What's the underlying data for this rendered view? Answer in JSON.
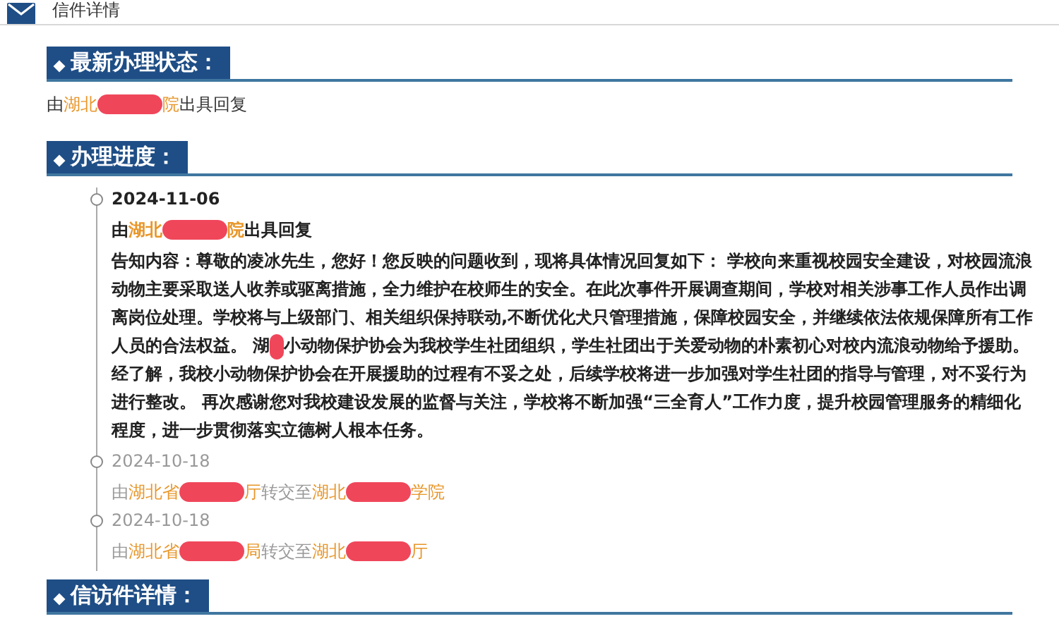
{
  "tab": {
    "title": "信件详情"
  },
  "latest_status": {
    "title": "最新办理状态：",
    "line": [
      {
        "kind": "text",
        "text": "由"
      },
      {
        "kind": "org",
        "text": "湖北"
      },
      {
        "kind": "redacted"
      },
      {
        "kind": "org",
        "text": "院"
      },
      {
        "kind": "text",
        "text": "出具回复"
      }
    ]
  },
  "progress": {
    "title": "办理进度：",
    "entries": [
      {
        "date": "2024-11-06",
        "current": true,
        "line": [
          {
            "kind": "text",
            "text": "由"
          },
          {
            "kind": "org",
            "text": "湖北"
          },
          {
            "kind": "redacted"
          },
          {
            "kind": "org",
            "text": "院"
          },
          {
            "kind": "text",
            "text": "出具回复"
          }
        ],
        "body": [
          {
            "kind": "text",
            "text": "告知内容：尊敬的凌冰先生，您好！您反映的问题收到，现将具体情况回复如下： 学校向来重视校园安全建设，对校园流浪动物主要采取送人收养或驱离措施，全力维护在校师生的安全。在此次事件开展调查期间，学校对相关涉事工作人员作出调离岗位处理。学校将与上级部门、相关组织保持联动,不断优化犬只管理措施，保障校园安全，并继续依法依规保障所有工作人员的合法权益。 湖"
          },
          {
            "kind": "redacted"
          },
          {
            "kind": "text",
            "text": "小动物保护协会为我校学生社团组织，学生社团出于关爱动物的朴素初心对校内流浪动物给予援助。经了解，我校小动物保护协会在开展援助的过程有不妥之处，后续学校将进一步加强对学生社团的指导与管理，对不妥行为进行整改。 再次感谢您对我校建设发展的监督与关注，学校将不断加强“三全育人”工作力度，提升校园管理服务的精细化程度，进一步贯彻落实立德树人根本任务。"
          }
        ]
      },
      {
        "date": "2024-10-18",
        "current": false,
        "line": [
          {
            "kind": "text",
            "text": "由"
          },
          {
            "kind": "org",
            "text": "湖北省"
          },
          {
            "kind": "redacted"
          },
          {
            "kind": "org",
            "text": "厅"
          },
          {
            "kind": "text",
            "text": "转交至"
          },
          {
            "kind": "org",
            "text": "湖北"
          },
          {
            "kind": "redacted"
          },
          {
            "kind": "org",
            "text": "学院"
          }
        ]
      },
      {
        "date": "2024-10-18",
        "current": false,
        "line": [
          {
            "kind": "text",
            "text": "由"
          },
          {
            "kind": "org",
            "text": "湖北省"
          },
          {
            "kind": "redacted"
          },
          {
            "kind": "org",
            "text": "局"
          },
          {
            "kind": "text",
            "text": "转交至"
          },
          {
            "kind": "org",
            "text": "湖北"
          },
          {
            "kind": "redacted"
          },
          {
            "kind": "org",
            "text": "厅"
          }
        ]
      }
    ]
  },
  "petition_details": {
    "title": "信访件详情："
  }
}
